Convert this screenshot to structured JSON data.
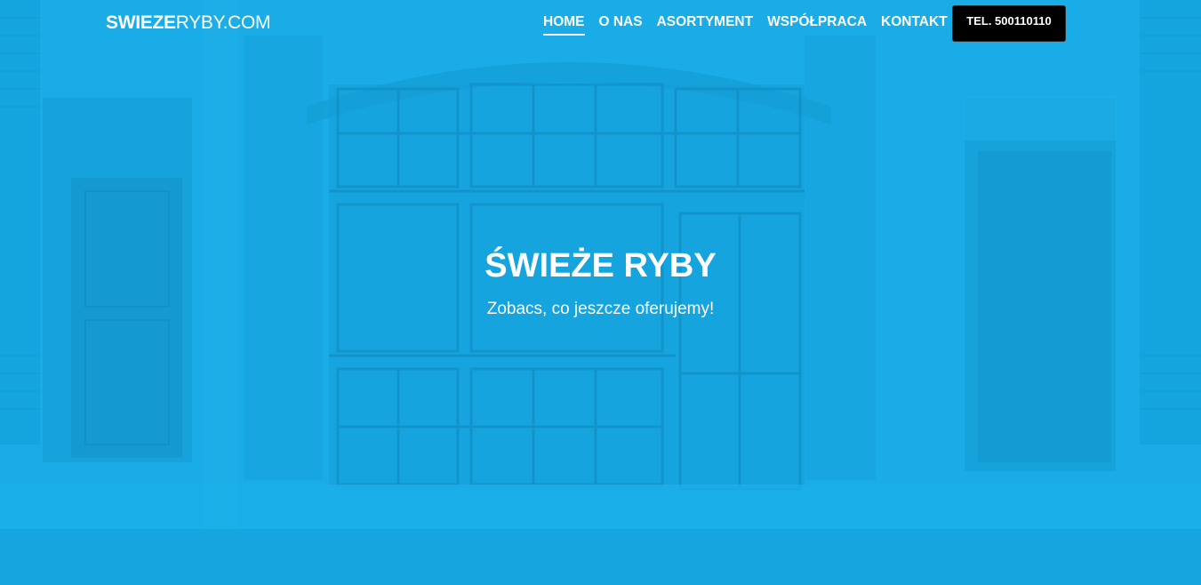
{
  "brand": {
    "bold": "SWIEZE",
    "light": "RYBY.COM"
  },
  "nav": {
    "items": [
      "HOME",
      "O NAS",
      "ASORTYMENT",
      "WSPÓŁPRACA",
      "KONTAKT"
    ],
    "active": "HOME",
    "phone_button": "TEL. 500110110"
  },
  "hero": {
    "title": "ŚWIEŻE RYBY",
    "subtitle": "Zobacs, co jeszcze oferujemy!"
  },
  "colors": {
    "overlay": "#19ace6",
    "text": "#ffffff",
    "phone_button_bg": "#000000"
  }
}
